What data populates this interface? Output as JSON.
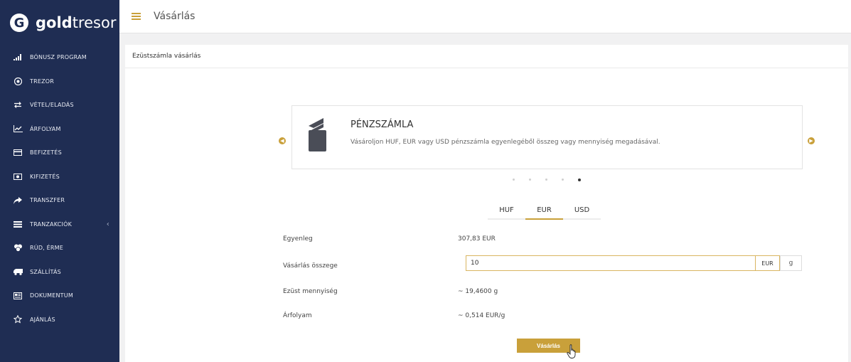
{
  "brand": {
    "logo_letter": "G",
    "name_bold": "gold",
    "name_light": "tresor"
  },
  "sidebar": {
    "items": [
      {
        "label": "BÓNUSZ PROGRAM",
        "icon": "signal-bars-icon"
      },
      {
        "label": "TREZOR",
        "icon": "vault-icon"
      },
      {
        "label": "VÉTEL/ELADÁS",
        "icon": "exchange-arrows-icon"
      },
      {
        "label": "ÁRFOLYAM",
        "icon": "line-chart-icon"
      },
      {
        "label": "BEFIZETÉS",
        "icon": "credit-card-icon"
      },
      {
        "label": "KIFIZETÉS",
        "icon": "banknote-icon"
      },
      {
        "label": "TRANSZFER",
        "icon": "share-arrow-icon"
      },
      {
        "label": "TRANZAKCIÓK",
        "icon": "list-icon",
        "caret": "‹"
      },
      {
        "label": "RÚD, ÉRME",
        "icon": "coins-icon"
      },
      {
        "label": "SZÁLLÍTÁS",
        "icon": "truck-icon"
      },
      {
        "label": "DOKUMENTUM",
        "icon": "document-icon"
      },
      {
        "label": "AJÁNLÁS",
        "icon": "star-icon"
      }
    ]
  },
  "header": {
    "title": "Vásárlás"
  },
  "panel": {
    "title": "Ezüstszámla vásárlás"
  },
  "carousel": {
    "title": "PÉNZSZÁMLA",
    "description": "Vásároljon HUF, EUR vagy USD pénzszámla egyenlegéből összeg vagy mennyiség megadásával.",
    "dot_count": 5,
    "active_dot": 5,
    "prev_icon": "chevron-left-icon",
    "next_icon": "chevron-right-icon"
  },
  "currency_tabs": [
    {
      "label": "HUF",
      "active": false
    },
    {
      "label": "EUR",
      "active": true
    },
    {
      "label": "USD",
      "active": false
    }
  ],
  "form": {
    "balance_label": "Egyenleg",
    "balance_value": "307,83  EUR",
    "amount_label": "Vásárlás összege",
    "amount_value": "10",
    "unit_eur": "EUR",
    "unit_g": "g",
    "silver_label": "Ezüst mennyiség",
    "silver_value": "~ 19,4600  g",
    "rate_label": "Árfolyam",
    "rate_value": "~ 0,514  EUR/g",
    "buy_button": "Vásárlás"
  },
  "colors": {
    "sidebar": "#1f2d53",
    "accent": "#c9a03a",
    "background": "#f1f1f2"
  }
}
